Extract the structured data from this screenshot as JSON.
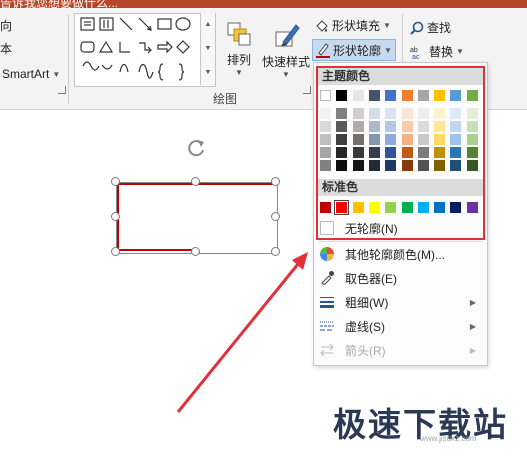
{
  "window": {
    "title": "告诉我您想要做什么..."
  },
  "ribbon": {
    "left_fragments": [
      "向",
      "本"
    ],
    "smartart_label": "SmartArt",
    "arrange_label": "排列",
    "quick_styles_label": "快速样式",
    "shape_fill_label": "形状填充",
    "shape_outline_label": "形状轮廓",
    "find_label": "查找",
    "replace_label": "替换",
    "drawing_group_label": "绘图"
  },
  "menu": {
    "theme_colors_header": "主题颜色",
    "standard_colors_header": "标准色",
    "no_outline_label": "无轮廓(N)",
    "items": [
      {
        "label": "其他轮廓颜色(M)...",
        "icon": "color-wheel-icon",
        "submenu": false,
        "enabled": true
      },
      {
        "label": "取色器(E)",
        "icon": "eyedropper-icon",
        "submenu": false,
        "enabled": true
      },
      {
        "label": "粗细(W)",
        "icon": "line-weight-icon",
        "submenu": true,
        "enabled": true
      },
      {
        "label": "虚线(S)",
        "icon": "dashes-icon",
        "submenu": true,
        "enabled": true
      },
      {
        "label": "箭头(R)",
        "icon": "arrows-icon",
        "submenu": true,
        "enabled": false
      }
    ],
    "theme_colors": [
      [
        "#ffffff",
        "#f2f2f2",
        "#d9d9d9",
        "#bfbfbf",
        "#a6a6a6",
        "#808080"
      ],
      [
        "#000000",
        "#7f7f7f",
        "#595959",
        "#3f3f3f",
        "#262626",
        "#0d0d0d"
      ],
      [
        "#e7e6e6",
        "#d0cece",
        "#aeabab",
        "#757070",
        "#3a3838",
        "#171616"
      ],
      [
        "#44546a",
        "#d6dce4",
        "#adb9ca",
        "#8497b0",
        "#333f4f",
        "#222a35"
      ],
      [
        "#4472c4",
        "#dae3f3",
        "#b4c7e7",
        "#8faadc",
        "#2f5597",
        "#203864"
      ],
      [
        "#ed7d31",
        "#fbe5d6",
        "#f8cbad",
        "#f4b183",
        "#c55a11",
        "#843c0c"
      ],
      [
        "#a5a5a5",
        "#ededed",
        "#dbdbdb",
        "#c9c9c9",
        "#7b7b7b",
        "#525252"
      ],
      [
        "#ffc000",
        "#fff2cc",
        "#ffe699",
        "#ffd966",
        "#bf9000",
        "#7f6000"
      ],
      [
        "#5b9bd5",
        "#deebf7",
        "#bdd7ee",
        "#9dc3e6",
        "#2e75b6",
        "#1f4e79"
      ],
      [
        "#70ad47",
        "#e2f0d9",
        "#c5e0b4",
        "#a9d18e",
        "#548235",
        "#385723"
      ]
    ],
    "standard_colors": [
      "#c00000",
      "#ff0000",
      "#ffc000",
      "#ffff00",
      "#92d050",
      "#00b050",
      "#00b0f0",
      "#0070c0",
      "#002060",
      "#7030a0"
    ],
    "selected_standard_index": 1
  },
  "colors": {
    "outline_accent": "#c00000",
    "highlight_box": "#e0303a",
    "arrow": "#e0303a"
  },
  "watermark": {
    "text": "极速下载站",
    "sub": "www.jisuxz.com"
  }
}
